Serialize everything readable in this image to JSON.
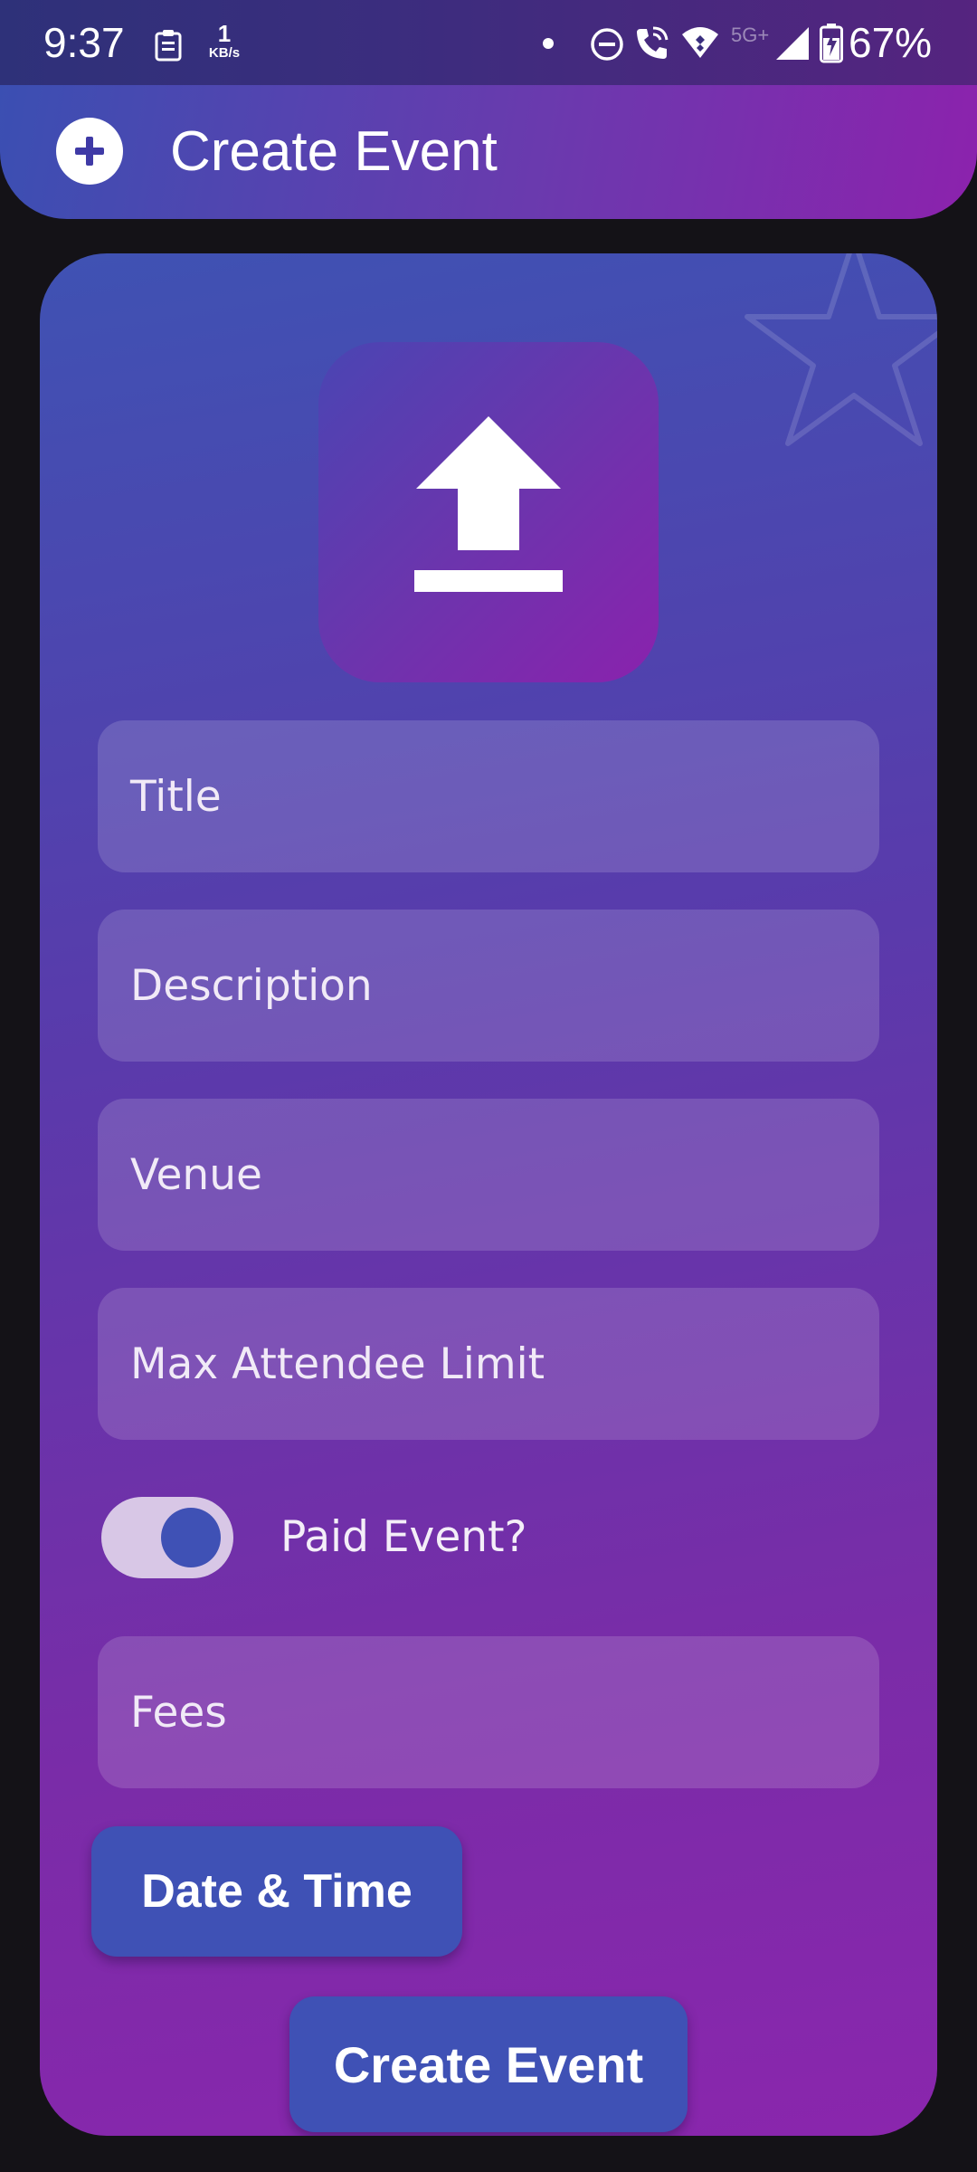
{
  "status_bar": {
    "time": "9:37",
    "net_speed_value": "1",
    "net_speed_unit": "KB/s",
    "network_label": "5G+",
    "battery": "67%"
  },
  "app_bar": {
    "title": "Create Event",
    "icon": "plus-circle-icon"
  },
  "form": {
    "upload_icon": "upload-icon",
    "title_placeholder": "Title",
    "description_placeholder": "Description",
    "venue_placeholder": "Venue",
    "max_attendee_placeholder": "Max Attendee Limit",
    "paid_event": {
      "label": "Paid Event?",
      "on": true
    },
    "fees_placeholder": "Fees",
    "date_time_button": "Date & Time",
    "create_button": "Create Event"
  },
  "colors": {
    "accent": "#3f51b5",
    "gradient_start": "#3f51b5",
    "gradient_end": "#8e24aa",
    "toggle_track": "#d8c7e6"
  }
}
